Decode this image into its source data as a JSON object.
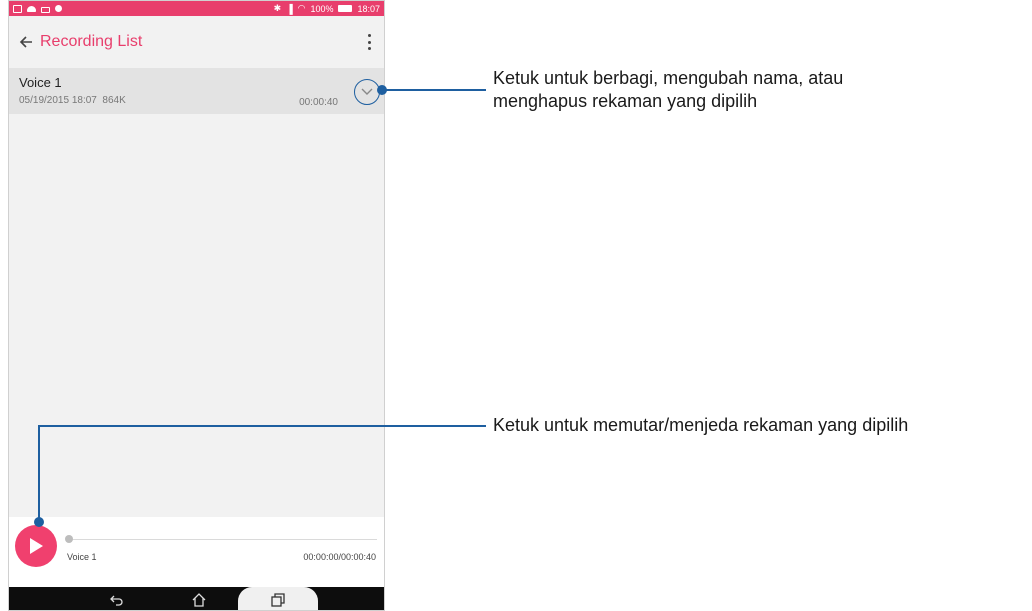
{
  "status_bar": {
    "battery": "100%",
    "time": "18:07"
  },
  "app_bar": {
    "title": "Recording List"
  },
  "recording": {
    "name": "Voice 1",
    "date": "05/19/2015 18:07",
    "size": "864K",
    "duration": "00:00:40"
  },
  "player": {
    "track_name": "Voice 1",
    "time": "00:00:00/00:00:40",
    "progress": 0
  },
  "callouts": {
    "expand": [
      "Ketuk untuk berbagi, mengubah nama, atau",
      "menghapus rekaman yang dipilih"
    ],
    "play": "Ketuk untuk memutar/menjeda rekaman yang dipilih"
  },
  "colors": {
    "accent": "#e83e6c",
    "play_button": "#f0406e",
    "callout_line": "#1e5fa0"
  },
  "icons": [
    "back-arrow-icon",
    "overflow-menu-icon",
    "chevron-down-icon",
    "play-icon",
    "nav-back-icon",
    "nav-home-icon",
    "nav-recents-icon"
  ]
}
